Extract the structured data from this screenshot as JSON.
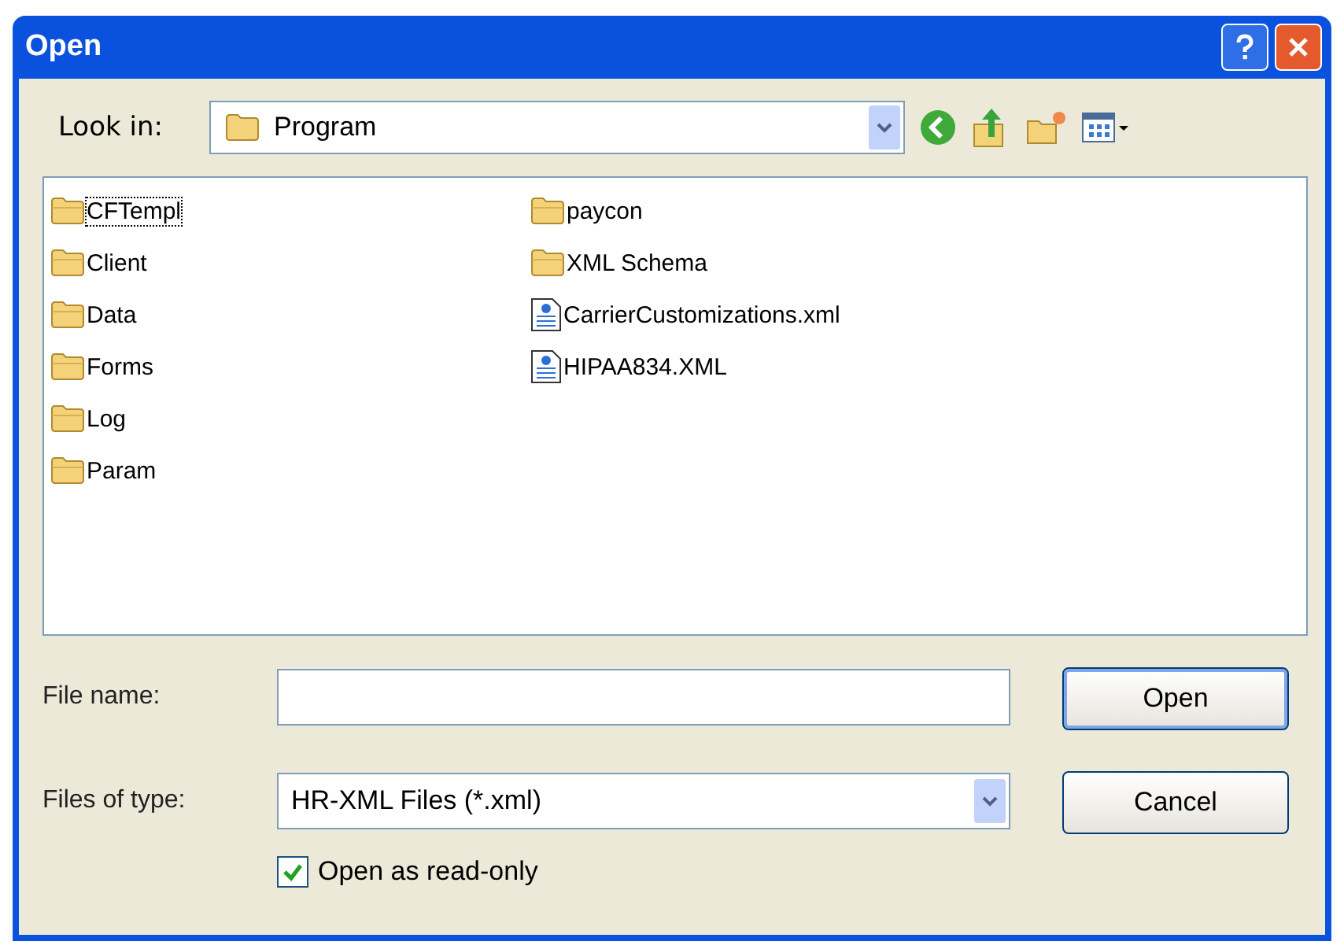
{
  "window": {
    "title": "Open"
  },
  "look_in": {
    "label": "Look in:",
    "value": "Program"
  },
  "files": [
    {
      "name": "CFTempl",
      "kind": "folder",
      "selected": true
    },
    {
      "name": "Client",
      "kind": "folder",
      "selected": false
    },
    {
      "name": "Data",
      "kind": "folder",
      "selected": false
    },
    {
      "name": "Forms",
      "kind": "folder",
      "selected": false
    },
    {
      "name": "Log",
      "kind": "folder",
      "selected": false
    },
    {
      "name": "Param",
      "kind": "folder",
      "selected": false
    },
    {
      "name": "paycon",
      "kind": "folder",
      "selected": false
    },
    {
      "name": "XML Schema",
      "kind": "folder",
      "selected": false
    },
    {
      "name": "CarrierCustomizations.xml",
      "kind": "xml",
      "selected": false
    },
    {
      "name": "HIPAA834.XML",
      "kind": "xml",
      "selected": false
    }
  ],
  "file_name": {
    "label": "File name:"
  },
  "files_of_type": {
    "label": "Files of type:",
    "value": "HR-XML Files (*.xml)"
  },
  "read_only": {
    "label": "Open as read-only",
    "checked": true
  },
  "buttons": [
    "Open",
    "Cancel"
  ]
}
